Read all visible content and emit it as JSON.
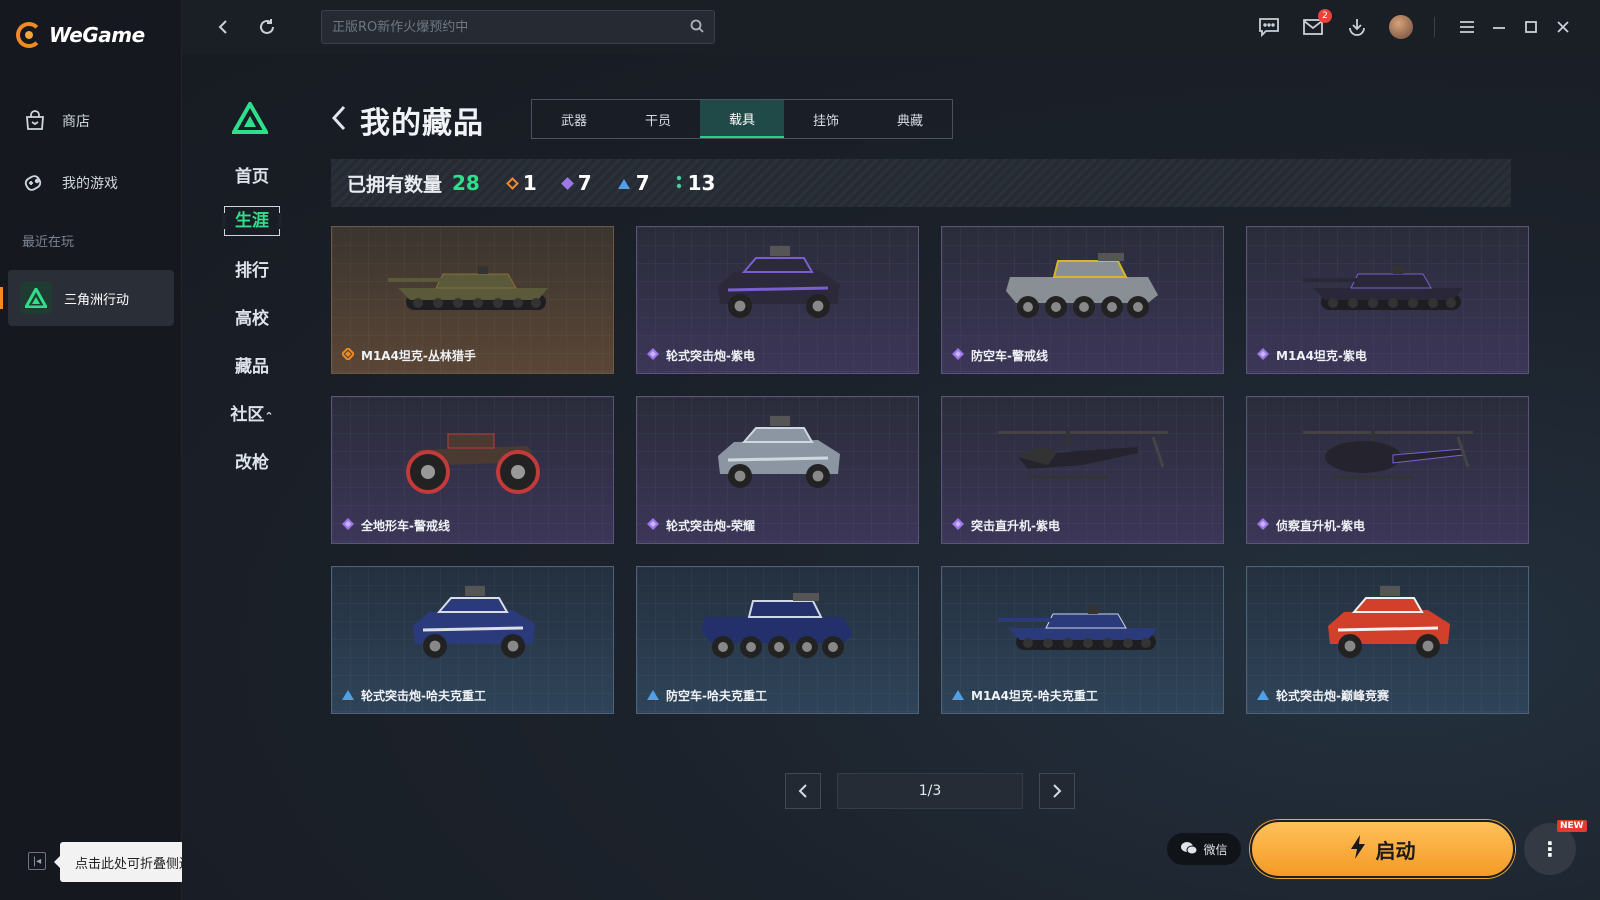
{
  "app": {
    "name": "WeGame"
  },
  "sidebar": {
    "items": [
      {
        "label": "商店",
        "icon": "store-bag-icon"
      },
      {
        "label": "我的游戏",
        "icon": "gamepad-icon"
      }
    ],
    "recent_label": "最近在玩",
    "recent_game": {
      "label": "三角洲行动",
      "icon": "delta-force-icon"
    },
    "collapse_tooltip": "点击此处可折叠侧边栏"
  },
  "topbar": {
    "search_placeholder": "正版RO新作火爆预约中",
    "mail_badge": "2"
  },
  "game_nav": {
    "items": [
      "首页",
      "生涯",
      "排行",
      "高校",
      "藏品",
      "社区",
      "改枪"
    ],
    "active": "生涯",
    "community_suffix": "⌃"
  },
  "collection": {
    "title": "我的藏品",
    "tabs": [
      "武器",
      "干员",
      "载具",
      "挂饰",
      "典藏"
    ],
    "active_tab": "载具",
    "owned_label": "已拥有数量",
    "owned_total": "28",
    "rarity_counts": [
      {
        "rarity": "legend",
        "color": "#f08a24",
        "count": "1"
      },
      {
        "rarity": "epic",
        "color": "#9d76e8",
        "count": "7"
      },
      {
        "rarity": "rare",
        "color": "#4fa0e6",
        "count": "7"
      },
      {
        "rarity": "common",
        "color": "#3fd49a",
        "count": "13"
      }
    ],
    "items": [
      {
        "name": "M1A4坦克-丛林猎手",
        "rarity": "legend",
        "type": "tank",
        "color": "#5a5a3a",
        "accent": "#8a6d3b"
      },
      {
        "name": "轮式突击炮-紫电",
        "rarity": "epic",
        "type": "car",
        "color": "#2c2a3a",
        "accent": "#7a5fd1"
      },
      {
        "name": "防空车-警戒线",
        "rarity": "epic",
        "type": "apc",
        "color": "#8a8f96",
        "accent": "#d6b52a"
      },
      {
        "name": "M1A4坦克-紫电",
        "rarity": "epic",
        "type": "tank",
        "color": "#2a2838",
        "accent": "#7a5fd1"
      },
      {
        "name": "全地形车-警戒线",
        "rarity": "epic",
        "type": "atv",
        "color": "#4a3a32",
        "accent": "#c33a3a"
      },
      {
        "name": "轮式突击炮-荣耀",
        "rarity": "epic",
        "type": "car",
        "color": "#8c96a3",
        "accent": "#cfd7e0"
      },
      {
        "name": "突击直升机-紫电",
        "rarity": "epic",
        "type": "heli",
        "color": "#25242e",
        "accent": "#7a5fd1"
      },
      {
        "name": "侦察直升机-紫电",
        "rarity": "epic",
        "type": "heli2",
        "color": "#25242e",
        "accent": "#7a5fd1"
      },
      {
        "name": "轮式突击炮-哈夫克重工",
        "rarity": "rare",
        "type": "car",
        "color": "#2a3a7a",
        "accent": "#d9dde6"
      },
      {
        "name": "防空车-哈夫克重工",
        "rarity": "rare",
        "type": "apc",
        "color": "#23306b",
        "accent": "#cfd6e8"
      },
      {
        "name": "M1A4坦克-哈夫克重工",
        "rarity": "rare",
        "type": "tank",
        "color": "#2a3a7a",
        "accent": "#cfd6e8"
      },
      {
        "name": "轮式突击炮-巅峰竞赛",
        "rarity": "rare",
        "type": "car",
        "color": "#d2402b",
        "accent": "#f2f2f2"
      }
    ],
    "page_indicator": "1/3"
  },
  "footer": {
    "wechat_label": "微信",
    "launch_label": "启动",
    "new_tag": "NEW"
  }
}
